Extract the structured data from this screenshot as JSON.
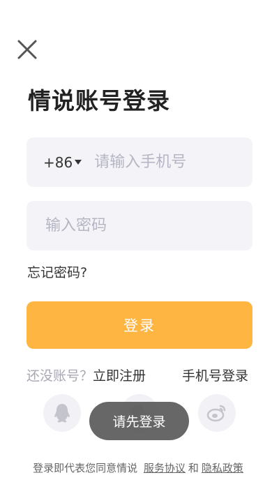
{
  "header": {
    "close_icon": "close-icon"
  },
  "title": "情说账号登录",
  "phone_field": {
    "country_code": "+86",
    "placeholder": "请输入手机号",
    "value": ""
  },
  "password_field": {
    "placeholder": "输入密码",
    "value": ""
  },
  "forgot_password": "忘记密码?",
  "login_button": "登录",
  "register": {
    "prompt": "还没账号？",
    "link": "立即注册"
  },
  "phone_login": "手机号登录",
  "social": {
    "icons": [
      "qq-icon",
      "wechat-icon",
      "weibo-icon"
    ]
  },
  "toast": "请先登录",
  "agreement": {
    "prefix": "登录即代表您同意情说",
    "service": "服务协议",
    "and": "和",
    "privacy": "隐私政策"
  },
  "colors": {
    "accent": "#ffb541",
    "field_bg": "#f4f4f8",
    "icon_gray": "#c4c4cc"
  }
}
